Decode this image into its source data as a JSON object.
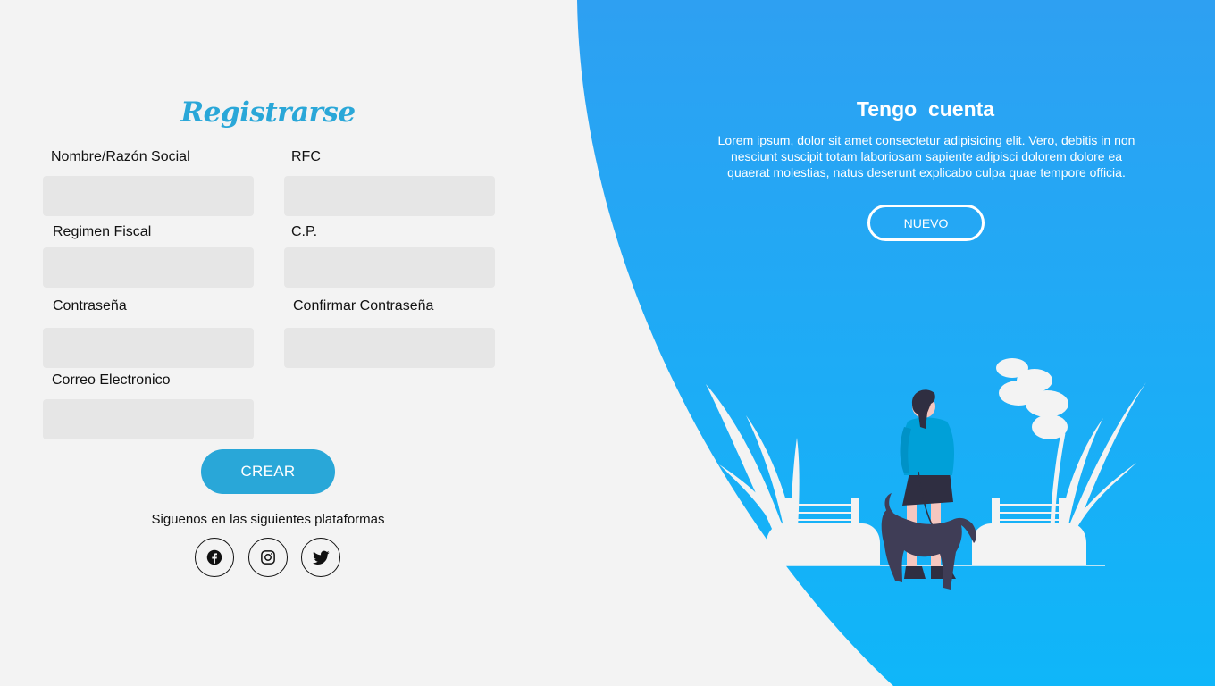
{
  "register": {
    "title": "Registrarse",
    "fields": {
      "nombre": {
        "label": "Nombre/Razón Social",
        "value": "",
        "placeholder": ""
      },
      "rfc": {
        "label": "RFC",
        "value": "",
        "placeholder": ""
      },
      "regimen": {
        "label": "Regimen Fiscal",
        "value": "",
        "placeholder": ""
      },
      "cp": {
        "label": "C.P.",
        "value": "",
        "placeholder": ""
      },
      "password": {
        "label": "Contraseña",
        "value": "",
        "placeholder": ""
      },
      "confirm": {
        "label": "Confirmar Contraseña",
        "value": "",
        "placeholder": ""
      },
      "email": {
        "label": "Correo Electronico",
        "value": "",
        "placeholder": ""
      }
    },
    "submit_label": "CREAR",
    "social_text": "Siguenos en las siguientes plataformas",
    "social_icons": [
      "facebook-icon",
      "instagram-icon",
      "twitter-icon"
    ]
  },
  "panel": {
    "title": "Tengo  cuenta",
    "text": "Lorem ipsum, dolor sit amet consectetur adipisicing elit. Vero, debitis in non nesciunt suscipit totam laboriosam sapiente adipisci dolorem dolore ea quaerat molestias, natus deserunt explicabo culpa quae tempore officia.",
    "button_label": "NUEVO"
  },
  "colors": {
    "accent": "#29a7d8",
    "panel_top": "#2ea0f2",
    "panel_bottom": "#0fb6f9",
    "background": "#f3f3f3",
    "field": "#e6e6e6"
  }
}
